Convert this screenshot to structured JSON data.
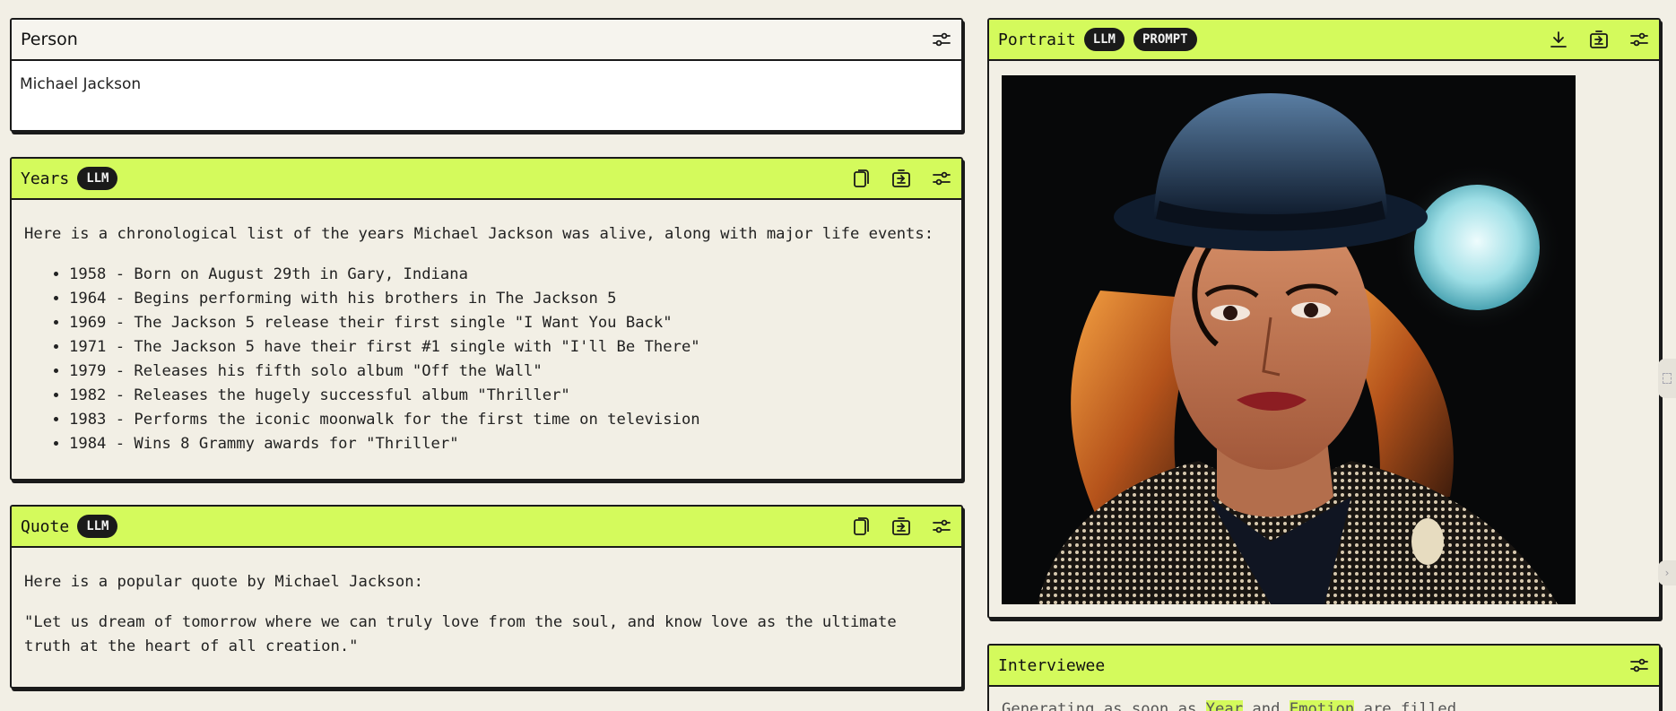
{
  "person": {
    "title": "Person",
    "value": "Michael Jackson"
  },
  "years": {
    "title": "Years",
    "badge": "LLM",
    "intro": "Here is a chronological list of the years Michael Jackson was alive, along with major life events:",
    "events": [
      "1958 - Born on August 29th in Gary, Indiana",
      "1964 - Begins performing with his brothers in The Jackson 5",
      "1969 - The Jackson 5 release their first single \"I Want You Back\"",
      "1971 - The Jackson 5 have their first #1 single with \"I'll Be There\"",
      "1979 - Releases his fifth solo album \"Off the Wall\"",
      "1982 - Releases the hugely successful album \"Thriller\"",
      "1983 - Performs the iconic moonwalk for the first time on television",
      "1984 - Wins 8 Grammy awards for \"Thriller\""
    ]
  },
  "quote": {
    "title": "Quote",
    "badge": "LLM",
    "intro": "Here is a popular quote by Michael Jackson:",
    "text": "\"Let us dream of tomorrow where we can truly love from the soul, and know love as the ultimate truth at the heart of all creation.\""
  },
  "portrait": {
    "title": "Portrait",
    "badges": [
      "LLM",
      "PROMPT"
    ]
  },
  "interviewee": {
    "title": "Interviewee",
    "status_prefix": "Generating as soon as ",
    "field_1": "Year",
    "status_middle": " and ",
    "field_2": "Emotion",
    "status_suffix": " are filled"
  },
  "colors": {
    "accent": "#d4fa5c",
    "background": "#f2efe5",
    "border": "#1a1a1a"
  },
  "icons": [
    "settings-sliders-icon",
    "copy-icon",
    "send-to-icon",
    "download-icon"
  ]
}
